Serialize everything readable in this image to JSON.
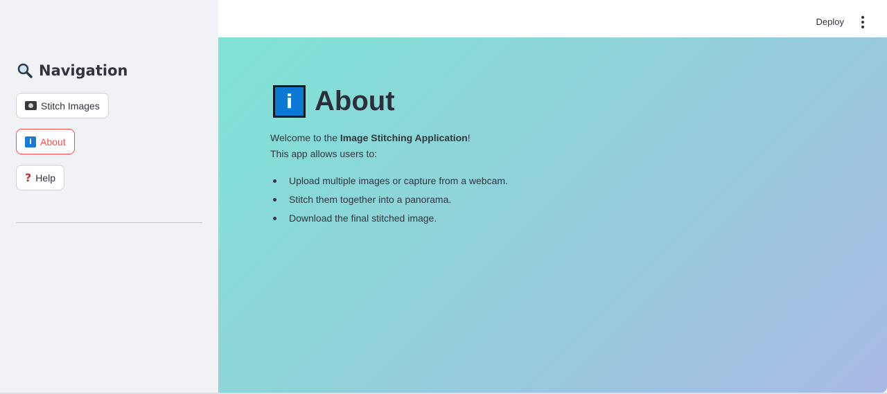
{
  "sidebar": {
    "title_icon": "magnifier-icon",
    "title": "Navigation",
    "items": [
      {
        "label": "Stitch Images",
        "icon": "camera-icon"
      },
      {
        "label": "About",
        "icon": "info-icon",
        "active": true
      },
      {
        "label": "Help",
        "icon": "question-icon"
      }
    ]
  },
  "header": {
    "deploy_label": "Deploy",
    "menu_icon": "kebab-menu-icon"
  },
  "main": {
    "title_icon_glyph": "i",
    "title": "About",
    "welcome_prefix": "Welcome to the ",
    "app_name": "Image Stitching Application",
    "welcome_suffix": "!",
    "allows": "This app allows users to:",
    "bullets": [
      "Upload multiple images or capture from a webcam.",
      "Stitch them together into a panorama.",
      "Download the final stitched image."
    ]
  },
  "colors": {
    "accent": "#ff4b4b",
    "sidebar_bg": "#f0f2f6",
    "gradient_start": "#7fe3d6",
    "gradient_end": "#a8b9e4",
    "info_blue": "#0b78d6"
  }
}
